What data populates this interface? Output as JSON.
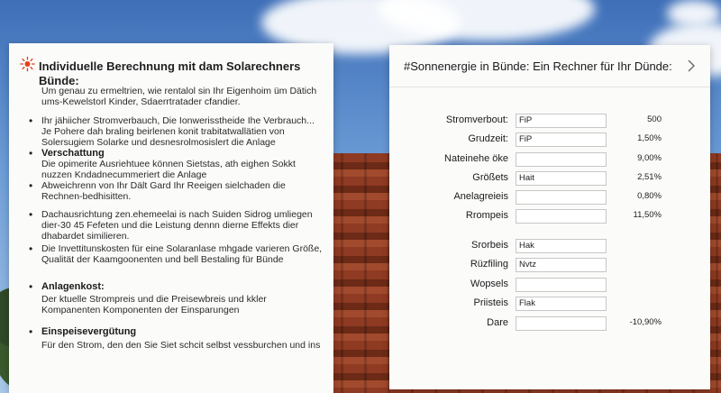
{
  "left": {
    "title": "Individuelle Berechnung mit dam Solarechners Bünde:",
    "intro": "Um genau zu ermeltrien, wie rentalol sin Ihr Eigenhoim üm Dätich ums-Kewelstorl Kinder, Sdaerrtratader cfandier.",
    "items": [
      {
        "heading": "",
        "text": "Ihr jähiicher Stromverbauch, Die Ionwerisstheide Ihe Verbrauch... Je Pohere dah braling beirlenen konit trabitatwallätien von Solersugiem Solarke und desnesrolmosislert die Anlage"
      },
      {
        "heading": "Verschattung",
        "text": "Die opimerite Ausriehtuee können Sietstas, ath eighen Sokkt nuzzen Kndadnecummeriert die Anlage"
      },
      {
        "heading": "",
        "text": "Abweichrenn von Ihr Dält Gard Ihr Reeigen sielchaden die Rechnen-bedhisitten."
      },
      {
        "heading": "",
        "text": "Dachausrichtung zen.ehemeelai is nach Suiden Sidrog umliegen dier-30 45 Fefeten und die Leistung dennn dierne Effekts dier dhabardet similieren."
      },
      {
        "heading": "",
        "text": "Die Invettitunskosten für eine Solaranlase mhgade varieren Größe, Qualität der Kaamgoonenten und bell Bestaling für Bünde"
      },
      {
        "heading": "Anlagenkost:",
        "text": "Der ktuelle Strompreis und die Preisewbreis und kkler Kompanenten Komponenten der Einsparungen"
      },
      {
        "heading": "Einspeisevergütung",
        "text": "Für den Strom, den den Sie Siet schcit selbst vessburchen und ins"
      }
    ]
  },
  "right": {
    "title": "#Sonnenergie in Bünde: Ein Rechner für Ihr Dünde:",
    "rows": [
      {
        "label": "Stromverbout:",
        "input": "FiP",
        "value": "500"
      },
      {
        "label": "Grudzeit:",
        "input": "FiP",
        "value": "1,50%"
      },
      {
        "label": "Nateinehe öke",
        "input": "",
        "value": "9,00%"
      },
      {
        "label": "Größets",
        "input": "Hait",
        "value": "2,51%"
      },
      {
        "label": "Anelagreieis",
        "input": "",
        "value": "0,80%"
      },
      {
        "label": "Rrompeis",
        "input": "",
        "value": "11,50%"
      },
      {
        "label": "Srorbeis",
        "input": "Hak",
        "value": ""
      },
      {
        "label": "Rüzfiling",
        "input": "Nvtz",
        "value": ""
      },
      {
        "label": "Wopsels",
        "input": "",
        "value": ""
      },
      {
        "label": "Priisteis",
        "input": "Flak",
        "value": ""
      },
      {
        "label": "Dare",
        "input": "",
        "value": "-10,90%"
      }
    ]
  },
  "icons": {
    "left_header": "sun-icon",
    "right_header": "chevron-right-icon"
  },
  "colors": {
    "accent": "#e2401c",
    "card": "#fbfbfa",
    "border": "#c6c6c6"
  }
}
